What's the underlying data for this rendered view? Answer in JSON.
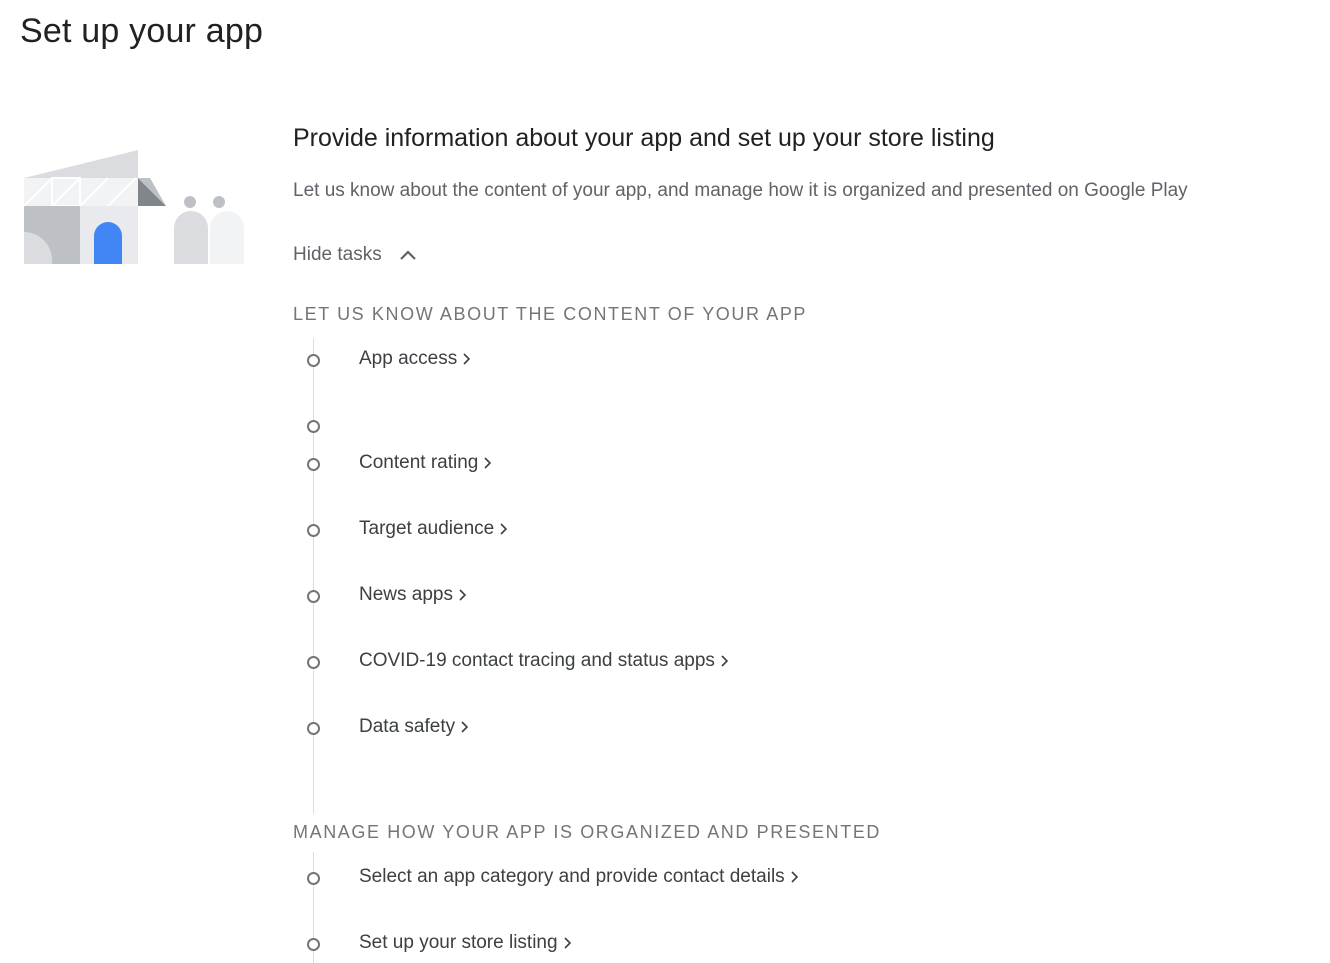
{
  "page": {
    "title": "Set up your app"
  },
  "setup": {
    "heading": "Provide information about your app and set up your store listing",
    "description": "Let us know about the content of your app, and manage how it is organized and presented on Google Play",
    "toggle_label": "Hide tasks"
  },
  "groups": [
    {
      "heading": "LET US KNOW ABOUT THE CONTENT OF YOUR APP",
      "tasks": [
        {
          "label": "App access"
        },
        {
          "label": ""
        },
        {
          "label": "Content rating"
        },
        {
          "label": "Target audience"
        },
        {
          "label": "News apps"
        },
        {
          "label": "COVID-19 contact tracing and status apps"
        },
        {
          "label": "Data safety"
        }
      ]
    },
    {
      "heading": "MANAGE HOW YOUR APP IS ORGANIZED AND PRESENTED",
      "tasks": [
        {
          "label": "Select an app category and provide contact details"
        },
        {
          "label": "Set up your store listing"
        }
      ]
    }
  ],
  "icons": {
    "toggle": "chevron-up-icon",
    "task_arrow": "chevron-right-icon",
    "task_status": "incomplete-circle-icon"
  },
  "colors": {
    "accent_blue": "#4285f4",
    "muted_text": "#5f6368",
    "heading_text": "#202124"
  }
}
